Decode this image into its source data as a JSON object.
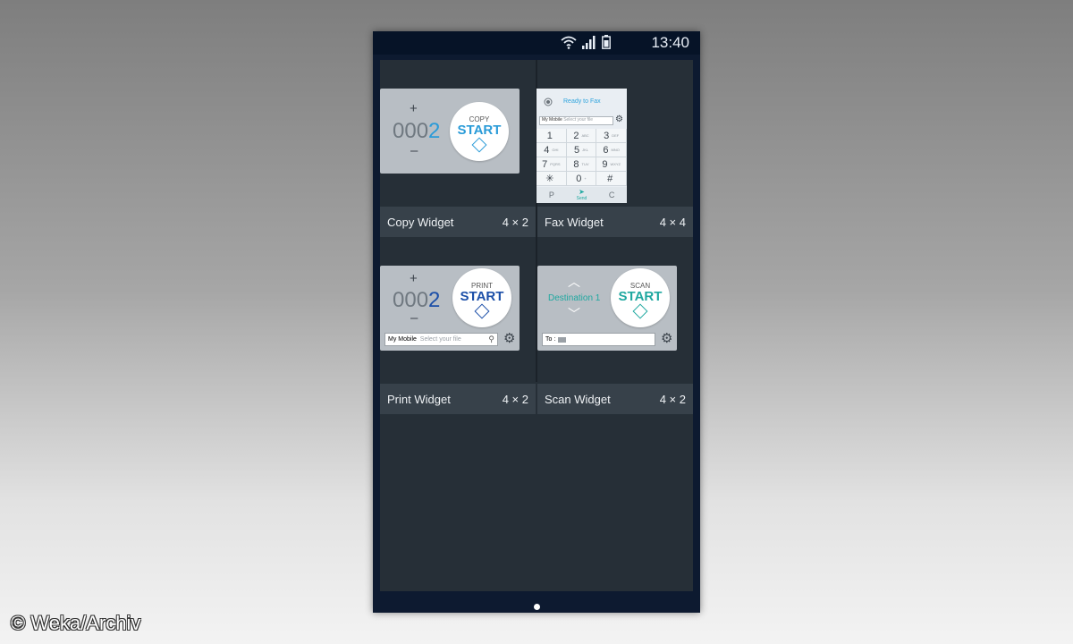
{
  "status_bar": {
    "time": "13:40",
    "icons": [
      "wifi-icon",
      "signal-icon",
      "battery-icon"
    ]
  },
  "widgets": [
    {
      "name": "Copy Widget",
      "size": "4 × 2",
      "preview": {
        "plus": "+",
        "count_prefix": "000",
        "count_last": "2",
        "minus": "–",
        "circle_small": "COPY",
        "circle_big": "START",
        "accent": "#2a9bd8"
      }
    },
    {
      "name": "Fax Widget",
      "size": "4 × 4",
      "preview": {
        "status": "Ready to Fax",
        "file_source": "My Mobile",
        "file_placeholder": "Select your file",
        "keys": [
          {
            "num": "1",
            "sub": ""
          },
          {
            "num": "2",
            "sub": "ABC"
          },
          {
            "num": "3",
            "sub": "DEF"
          },
          {
            "num": "4",
            "sub": "GHI"
          },
          {
            "num": "5",
            "sub": "JKL"
          },
          {
            "num": "6",
            "sub": "MNO"
          },
          {
            "num": "7",
            "sub": "PQRS"
          },
          {
            "num": "8",
            "sub": "TUV"
          },
          {
            "num": "9",
            "sub": "WXYZ"
          },
          {
            "num": "✳",
            "sub": ""
          },
          {
            "num": "0",
            "sub": "+"
          },
          {
            "num": "#",
            "sub": ""
          }
        ],
        "action_left": "P",
        "action_center": "Send",
        "action_right": "C",
        "accent": "#2fa4dd"
      }
    },
    {
      "name": "Print Widget",
      "size": "4 × 2",
      "preview": {
        "plus": "+",
        "count_prefix": "000",
        "count_last": "2",
        "minus": "–",
        "circle_small": "PRINT",
        "circle_big": "START",
        "file_source": "My Mobile",
        "file_placeholder": "Select your file",
        "accent": "#1c4fa8"
      }
    },
    {
      "name": "Scan Widget",
      "size": "4 × 2",
      "preview": {
        "destination": "Destination 1",
        "circle_small": "SCAN",
        "circle_big": "START",
        "to_label": "To :",
        "accent": "#1fa8a0"
      }
    }
  ],
  "watermark": "© Weka/Archiv"
}
